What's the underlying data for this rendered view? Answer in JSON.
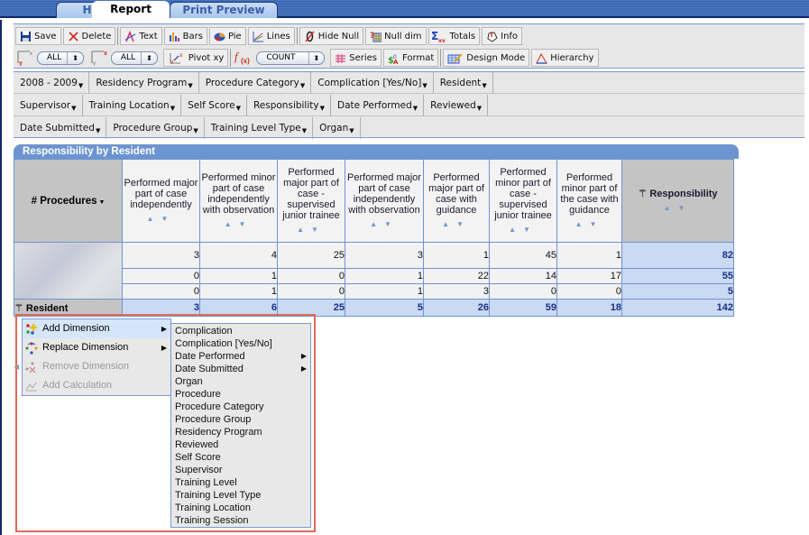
{
  "tabs": [
    {
      "label": "Home",
      "active": false
    },
    {
      "label": "Report",
      "active": true
    },
    {
      "label": "Print Preview",
      "active": false
    }
  ],
  "toolbar": {
    "row1": [
      {
        "id": "save",
        "label": "Save",
        "icon": "floppy-disk-icon"
      },
      {
        "id": "delete",
        "label": "Delete",
        "icon": "x-icon"
      },
      {
        "id": "text",
        "label": "Text",
        "icon": "text-style-icon"
      },
      {
        "id": "bars",
        "label": "Bars",
        "icon": "bar-chart-icon"
      },
      {
        "id": "pie",
        "label": "Pie",
        "icon": "pie-chart-icon"
      },
      {
        "id": "lines",
        "label": "Lines",
        "icon": "line-chart-icon"
      },
      {
        "id": "hide-null",
        "label": "Hide Null",
        "icon": "null-slash-icon"
      },
      {
        "id": "null-dim",
        "label": "Null dim",
        "icon": "grid-question-icon"
      },
      {
        "id": "totals",
        "label": "Totals",
        "icon": "sigma-xy-icon"
      },
      {
        "id": "info",
        "label": "Info",
        "icon": "info-tag-icon"
      }
    ],
    "row2": {
      "y_axis_select": "ALL",
      "x_axis_select": "ALL",
      "pivot_label": "Pivot  xy",
      "function_select": "COUNT",
      "series_label": "Series",
      "format_label": "Format",
      "design_mode_label": "Design Mode",
      "hierarchy_label": "Hierarchy"
    }
  },
  "dimensions": {
    "row1": [
      "2008 - 2009",
      "Residency Program",
      "Procedure Category",
      "Complication [Yes/No]",
      "Resident"
    ],
    "row2": [
      "Supervisor",
      "Training Location",
      "Self Score",
      "Responsibility",
      "Date Performed",
      "Reviewed"
    ],
    "row3": [
      "Date Submitted",
      "Procedure Group",
      "Training Level Type",
      "Organ"
    ]
  },
  "report": {
    "title": "Responsibility by Resident",
    "corner_label": "# Procedures",
    "columns": [
      "Performed major part of case independently",
      "Performed minor part of case independently with observation",
      "Performed major part of case - supervised junior trainee",
      "Performed major part of case independently with observation",
      "Performed major part of case with guidance",
      "Performed minor part of case - supervised junior trainee",
      "Performed minor part of the case with guidance"
    ],
    "total_column_label": "Responsibility",
    "rows": [
      {
        "values": [
          3,
          4,
          25,
          3,
          1,
          45,
          1
        ],
        "total": 82
      },
      {
        "values": [
          0,
          1,
          0,
          1,
          22,
          14,
          17
        ],
        "total": 55
      },
      {
        "values": [
          0,
          1,
          0,
          1,
          3,
          0,
          0
        ],
        "total": 5
      }
    ],
    "footer_label": "Resident",
    "footer_values": [
      3,
      6,
      25,
      5,
      26,
      59,
      18
    ],
    "grand_total": 142
  },
  "context_menu": {
    "items": [
      {
        "label": "Add Dimension",
        "enabled": true,
        "highlighted": true,
        "submenu": true
      },
      {
        "label": "Replace Dimension",
        "enabled": true,
        "highlighted": false,
        "submenu": true
      },
      {
        "label": "Remove Dimension",
        "enabled": false,
        "highlighted": false,
        "submenu": false
      },
      {
        "label": "Add Calculation",
        "enabled": false,
        "highlighted": false,
        "submenu": false
      }
    ],
    "submenu_items": [
      {
        "label": "Complication",
        "submenu": false
      },
      {
        "label": "Complication [Yes/No]",
        "submenu": false
      },
      {
        "label": "Date Performed",
        "submenu": true
      },
      {
        "label": "Date Submitted",
        "submenu": true
      },
      {
        "label": "Organ",
        "submenu": false
      },
      {
        "label": "Procedure",
        "submenu": false
      },
      {
        "label": "Procedure Category",
        "submenu": false
      },
      {
        "label": "Procedure Group",
        "submenu": false
      },
      {
        "label": "Residency Program",
        "submenu": false
      },
      {
        "label": "Reviewed",
        "submenu": false
      },
      {
        "label": "Self Score",
        "submenu": false
      },
      {
        "label": "Supervisor",
        "submenu": false
      },
      {
        "label": "Training Level",
        "submenu": false
      },
      {
        "label": "Training Level Type",
        "submenu": false
      },
      {
        "label": "Training Location",
        "submenu": false
      },
      {
        "label": "Training Session",
        "submenu": false
      }
    ]
  },
  "colors": {
    "tab_bar": "#3c66b0",
    "accent_blue": "#6c94d0",
    "total_cell": "#c9daf2",
    "total_text": "#1b2f86",
    "highlight_frame": "#e06a58"
  }
}
